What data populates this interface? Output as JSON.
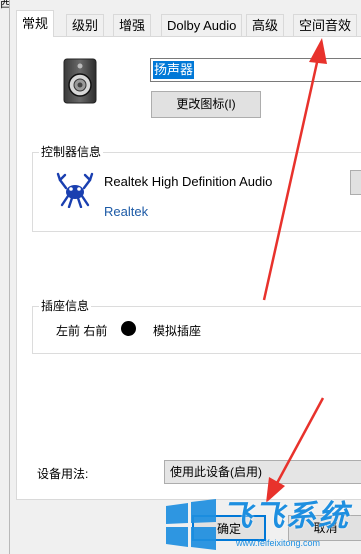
{
  "window": {
    "edge_glyph": "西"
  },
  "tabs": [
    {
      "label": "常规",
      "active": true
    },
    {
      "label": "级别"
    },
    {
      "label": "增强"
    },
    {
      "label": "Dolby Audio"
    },
    {
      "label": "高级"
    },
    {
      "label": "空间音效"
    }
  ],
  "device": {
    "name": "扬声器",
    "icon": "speaker-icon"
  },
  "buttons": {
    "change_icon": "更改图标(I)",
    "ok": "确定",
    "cancel": "取消"
  },
  "controller": {
    "group_label": "控制器信息",
    "name": "Realtek High Definition Audio",
    "vendor": "Realtek",
    "logo": "realtek-crab-icon"
  },
  "jack": {
    "group_label": "插座信息",
    "position": "左前 右前",
    "color": "#000000",
    "type": "模拟插座"
  },
  "usage": {
    "label": "设备用法:",
    "selected": "使用此设备(启用)"
  },
  "watermark": {
    "text": "飞飞系统",
    "url": "www.feifeixitong.com",
    "color": "#1e8fe0"
  },
  "colors": {
    "accent": "#0078d7",
    "annotation_arrow": "#e8322c"
  }
}
